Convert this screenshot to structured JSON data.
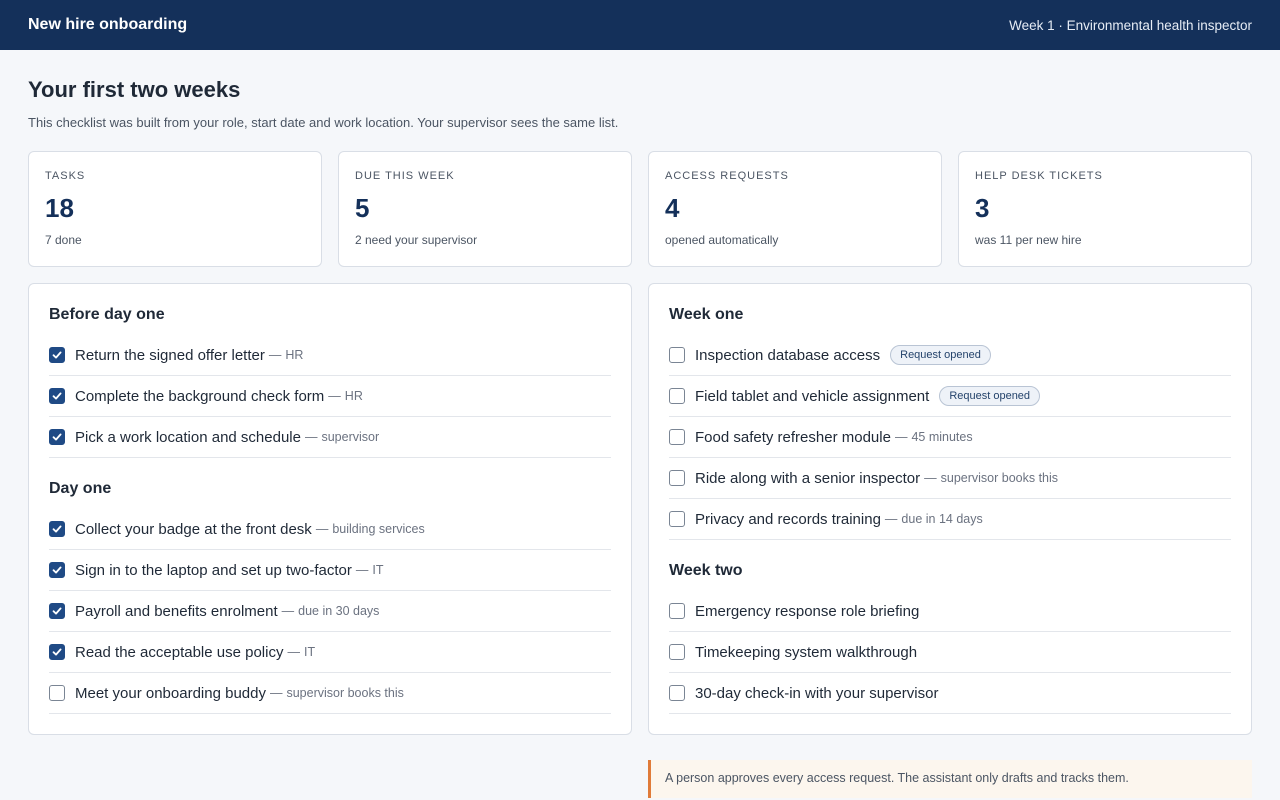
{
  "header": {
    "title": "New hire onboarding",
    "context": "Week 1 · Environmental health inspector"
  },
  "page": {
    "title": "Your first two weeks",
    "subtitle": "This checklist was built from your role, start date and work location. Your supervisor sees the same list."
  },
  "stats": [
    {
      "label": "TASKS",
      "value": "18",
      "note": "7 done"
    },
    {
      "label": "DUE THIS WEEK",
      "value": "5",
      "note": "2 need your supervisor"
    },
    {
      "label": "ACCESS REQUESTS",
      "value": "4",
      "note": "opened automatically"
    },
    {
      "label": "HELP DESK TICKETS",
      "value": "3",
      "note": "was 11 per new hire"
    }
  ],
  "sections": {
    "before_day_one": {
      "title": "Before day one",
      "tasks": [
        {
          "label": "Return the signed offer letter",
          "meta": "HR",
          "checked": true
        },
        {
          "label": "Complete the background check form",
          "meta": "HR",
          "checked": true
        },
        {
          "label": "Pick a work location and schedule",
          "meta": "supervisor",
          "checked": true
        }
      ]
    },
    "day_one": {
      "title": "Day one",
      "tasks": [
        {
          "label": "Collect your badge at the front desk",
          "meta": "building services",
          "checked": true
        },
        {
          "label": "Sign in to the laptop and set up two-factor",
          "meta": "IT",
          "checked": true
        },
        {
          "label": "Payroll and benefits enrolment",
          "meta": "due in 30 days",
          "checked": true
        },
        {
          "label": "Read the acceptable use policy",
          "meta": "IT",
          "checked": true
        },
        {
          "label": "Meet your onboarding buddy",
          "meta": "supervisor books this",
          "checked": false
        }
      ]
    },
    "week_one": {
      "title": "Week one",
      "tasks": [
        {
          "label": "Inspection database access",
          "badge": "Request opened",
          "checked": false
        },
        {
          "label": "Field tablet and vehicle assignment",
          "badge": "Request opened",
          "checked": false
        },
        {
          "label": "Food safety refresher module",
          "meta": "45 minutes",
          "checked": false
        },
        {
          "label": "Ride along with a senior inspector",
          "meta": "supervisor books this",
          "checked": false
        },
        {
          "label": "Privacy and records training",
          "meta": "due in 14 days",
          "checked": false
        }
      ]
    },
    "week_two": {
      "title": "Week two",
      "tasks": [
        {
          "label": "Emergency response role briefing",
          "checked": false
        },
        {
          "label": "Timekeeping system walkthrough",
          "checked": false
        },
        {
          "label": "30-day check-in with your supervisor",
          "checked": false
        }
      ]
    }
  },
  "meta_separator": "—",
  "note": "A person approves every access request. The assistant only drafts and tracks them.",
  "colors": {
    "header_bg": "#14305a",
    "accent": "#1f4a85",
    "note_border": "#e07b39"
  }
}
